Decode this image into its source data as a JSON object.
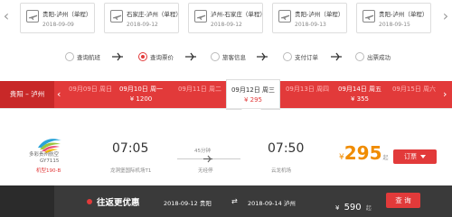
{
  "history": [
    {
      "route": "贵阳-泸州（单程）",
      "date": "2018-09-09"
    },
    {
      "route": "石家庄-泸州（单程）",
      "date": "2018-09-12"
    },
    {
      "route": "泸州-石家庄（单程）",
      "date": "2018-09-12"
    },
    {
      "route": "贵阳-泸州（单程）",
      "date": "2018-09-13"
    },
    {
      "route": "贵阳-泸州（单程）",
      "date": "2018-09-15"
    }
  ],
  "steps": [
    "查询航班",
    "查询票价",
    "旅客信息",
    "支付订单",
    "出票成功"
  ],
  "active_step": 1,
  "route_tag": "贵阳 – 泸州",
  "dates": [
    {
      "d": "09月09日 周日",
      "p": "",
      "state": "faded"
    },
    {
      "d": "09月10日 周一",
      "p": "¥ 1200",
      "state": "normal"
    },
    {
      "d": "09月11日 周二",
      "p": "",
      "state": "faded"
    },
    {
      "d": "09月12日 周三",
      "p": "¥ 295",
      "state": "selected"
    },
    {
      "d": "09月13日 周四",
      "p": "",
      "state": "faded"
    },
    {
      "d": "09月14日 周五",
      "p": "¥ 355",
      "state": "normal"
    },
    {
      "d": "09月15日 周六",
      "p": "",
      "state": "faded"
    }
  ],
  "flight": {
    "airline": "多彩贵州航空",
    "flight_no": "GY7115",
    "plane": "机型190-B",
    "dep_time": "07:05",
    "dep_airport": "龙洞堡国际机场T1",
    "duration": "45分钟",
    "stop": "无经停",
    "arr_time": "07:50",
    "arr_airport": "云龙机场",
    "price_currency": "¥",
    "price": "295",
    "price_suffix": "起",
    "book_label": "订票"
  },
  "bottom": {
    "promo": "往返更优惠",
    "out": "2018-09-12 贵阳",
    "back": "2018-09-14 泸州",
    "price_currency": "¥",
    "price": "590",
    "price_suffix": "起",
    "search_label": "查 询"
  },
  "colors": {
    "accent": "#e23a3a",
    "price": "#f08c00",
    "dark": "#3a3a3a"
  }
}
